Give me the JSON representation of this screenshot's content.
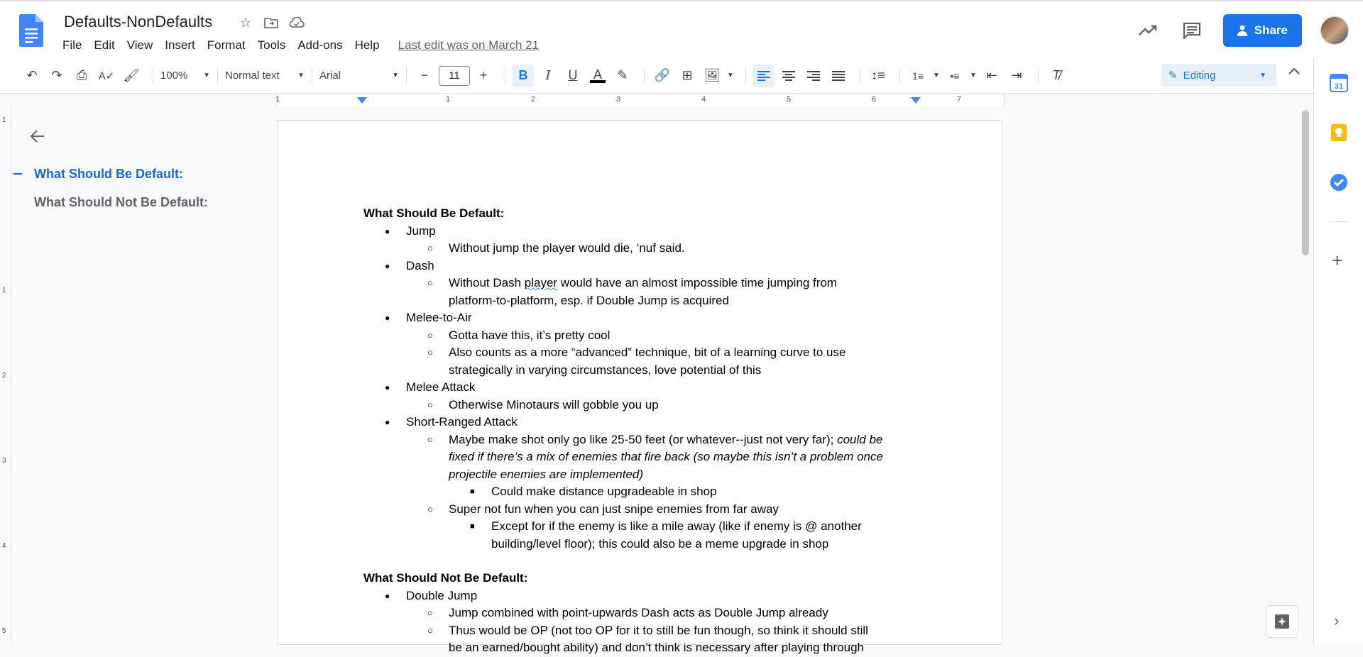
{
  "app": {
    "doc_title": "Defaults-NonDefaults",
    "last_edit": "Last edit was on March 21",
    "share_label": "Share",
    "menu": [
      "File",
      "Edit",
      "View",
      "Insert",
      "Format",
      "Tools",
      "Add-ons",
      "Help"
    ]
  },
  "toolbar": {
    "zoom": "100%",
    "style": "Normal text",
    "font": "Arial",
    "font_size": "11",
    "mode": "Editing"
  },
  "ruler": [
    "1",
    "1",
    "2",
    "3",
    "4",
    "5",
    "6",
    "7"
  ],
  "vruler": [
    "1",
    "1",
    "2",
    "3",
    "4",
    "5"
  ],
  "outline": {
    "items": [
      "What Should Be Default:",
      "What Should Not Be Default:"
    ]
  },
  "doc": {
    "h1": "What Should Be Default:",
    "jump": "Jump",
    "jump_1": "Without jump the player would die, ‘nuf said.",
    "dash": "Dash",
    "dash_1a": "Without Dash ",
    "dash_1b": "player",
    "dash_1c": " would have an almost impossible time jumping from",
    "dash_1d": "platform-to-platform, esp. if Double Jump is acquired",
    "melee_air": "Melee-to-Air",
    "melee_air_1": "Gotta have this, it’s pretty cool",
    "melee_air_2a": "Also counts as a more “advanced” technique, bit of a learning curve to use",
    "melee_air_2b": "strategically in varying circumstances, love potential of this",
    "melee": "Melee Attack",
    "melee_1": "Otherwise Minotaurs will gobble you up",
    "short": "Short-Ranged Attack",
    "short_1a": "Maybe make shot only go like 25-50 feet (or whatever--just not very far); ",
    "short_1b": "could be",
    "short_1c": "fixed if there’s a mix of enemies that fire back (so maybe this isn’t a problem once",
    "short_1d": "projectile enemies are implemented)",
    "short_1_1": "Could make distance upgradeable in shop",
    "short_2": "Super not fun when you can just snipe enemies from far away",
    "short_2_1a": "Except for if the enemy is like a mile away (like if enemy is @ another",
    "short_2_1b": "building/level floor); this could also be a meme upgrade in shop",
    "h2": "What Should Not Be Default:",
    "djump": "Double Jump",
    "djump_1": "Jump combined with point-upwards Dash acts as Double Jump already",
    "djump_2a": "Thus would be OP (not too OP for it to still be fun though, so think it should still",
    "djump_2b": "be an earned/bought ability) and don’t think is necessary after playing through"
  },
  "colors": {
    "accent": "#1a73e8",
    "outline_active": "#1967d2"
  }
}
